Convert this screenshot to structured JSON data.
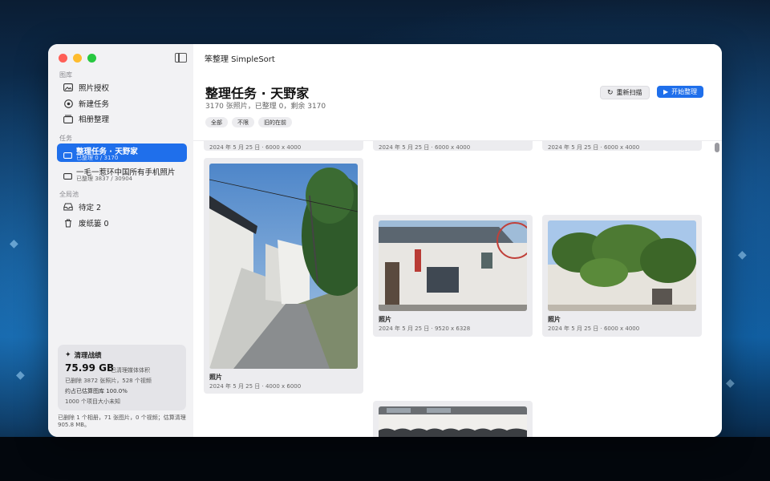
{
  "app_title": "笨整理 SimpleSort",
  "sidebar": {
    "section_library": "图库",
    "library_items": [
      {
        "label": "照片授权",
        "icon": "photos-icon"
      },
      {
        "label": "新建任务",
        "icon": "add-circle-icon"
      },
      {
        "label": "相册整理",
        "icon": "albums-icon"
      }
    ],
    "section_tasks": "任务",
    "tasks": [
      {
        "title": "整理任务 · 天野家",
        "progress": "已整理 0 / 3170",
        "active": true
      },
      {
        "title": "一毛一惹环中国所有手机照片",
        "progress": "已整理 3837 / 30904",
        "active": false
      }
    ],
    "section_global": "全局池",
    "global_items": [
      {
        "label": "待定 2",
        "icon": "tray-icon"
      },
      {
        "label": "废纸篓 0",
        "icon": "trash-icon"
      }
    ],
    "stats": {
      "title": "清理战绩",
      "size": "75.99 GB",
      "size_caption": "已清理媒体体积",
      "deleted": "已删除 3872 张照片，528 个视频",
      "ratio": "约占已估算图库 100.0%",
      "unknown": "1000 个项目大小未知"
    },
    "footer_note": "已删除 1 个相册，71 张图片，0 个视频；估算清理 905.8 MB。"
  },
  "header": {
    "title": "整理任务 · 天野家",
    "subtitle": "3170 张照片，已整理 0，剩余 3170",
    "filters": [
      "全部",
      "不限",
      "旧的在前"
    ],
    "rescan_label": "重新扫描",
    "start_label": "开始整理"
  },
  "grid": {
    "top_row_captions": [
      "2024 年 5 月 25 日 · 6000 x 4000",
      "2024 年 5 月 25 日 · 6000 x 4000",
      "2024 年 5 月 25 日 · 6000 x 4000"
    ],
    "cards": [
      {
        "name": "照片",
        "caption": "2024 年 5 月 25 日 · 4000 x 6000"
      },
      {
        "name": "照片",
        "caption": "2024 年 5 月 25 日 · 9520 x 6328"
      },
      {
        "name": "照片",
        "caption": "2024 年 5 月 25 日 · 6000 x 4000"
      }
    ]
  },
  "colors": {
    "accent": "#1f6feb",
    "sidebar_bg": "#f2f2f4",
    "card_bg": "#ececef"
  }
}
